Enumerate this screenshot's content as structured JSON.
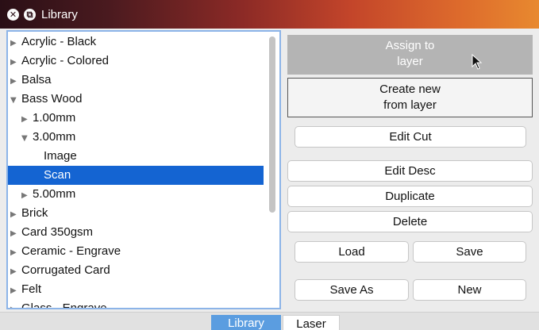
{
  "window": {
    "title": "Library"
  },
  "tree": {
    "rows": [
      {
        "label": "Acrylic - Black",
        "arrow": "▶",
        "level": 0,
        "selected": false
      },
      {
        "label": "Acrylic - Colored",
        "arrow": "▶",
        "level": 0,
        "selected": false
      },
      {
        "label": "Balsa",
        "arrow": "▶",
        "level": 0,
        "selected": false
      },
      {
        "label": "Bass Wood",
        "arrow": "▼",
        "level": 0,
        "selected": false
      },
      {
        "label": "1.00mm",
        "arrow": "▶",
        "level": 1,
        "selected": false
      },
      {
        "label": "3.00mm",
        "arrow": "▼",
        "level": 1,
        "selected": false
      },
      {
        "label": "Image",
        "arrow": "",
        "level": 2,
        "selected": false
      },
      {
        "label": "Scan",
        "arrow": "",
        "level": 2,
        "selected": true
      },
      {
        "label": "5.00mm",
        "arrow": "▶",
        "level": 1,
        "selected": false
      },
      {
        "label": "Brick",
        "arrow": "▶",
        "level": 0,
        "selected": false
      },
      {
        "label": "Card 350gsm",
        "arrow": "▶",
        "level": 0,
        "selected": false
      },
      {
        "label": "Ceramic - Engrave",
        "arrow": "▶",
        "level": 0,
        "selected": false
      },
      {
        "label": "Corrugated Card",
        "arrow": "▶",
        "level": 0,
        "selected": false
      },
      {
        "label": "Felt",
        "arrow": "▶",
        "level": 0,
        "selected": false
      },
      {
        "label": "Glass - Engrave",
        "arrow": "▶",
        "level": 0,
        "selected": false
      }
    ]
  },
  "buttons": {
    "assign_line1": "Assign to",
    "assign_line2": "layer",
    "create_line1": "Create new",
    "create_line2": "from layer",
    "edit_cut": "Edit Cut",
    "edit_desc": "Edit Desc",
    "duplicate": "Duplicate",
    "delete": "Delete",
    "load": "Load",
    "save": "Save",
    "save_as": "Save As",
    "new": "New"
  },
  "tabs": {
    "library": "Library",
    "laser": "Laser"
  },
  "colors": {
    "selection": "#1464d2",
    "active_tab": "#5b9de0",
    "tree_border": "#8cb4e8"
  }
}
